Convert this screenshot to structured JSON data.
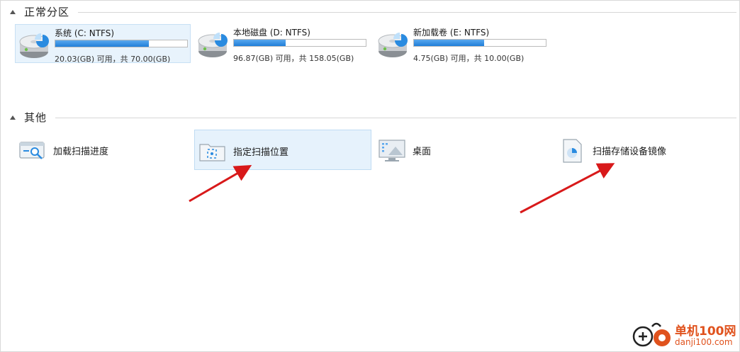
{
  "sections": {
    "normal_partitions": "正常分区",
    "other": "其他"
  },
  "drives": [
    {
      "name": "系统 (C: NTFS)",
      "capacity": "20.03(GB) 可用，共 70.00(GB)",
      "used_fraction": 0.71,
      "selected": true
    },
    {
      "name": "本地磁盘 (D: NTFS)",
      "capacity": "96.87(GB) 可用，共 158.05(GB)",
      "used_fraction": 0.39,
      "selected": false
    },
    {
      "name": "新加载卷 (E: NTFS)",
      "capacity": "4.75(GB) 可用，共 10.00(GB)",
      "used_fraction": 0.53,
      "selected": false
    }
  ],
  "items": [
    {
      "label": "加载扫描进度",
      "icon": "load-scan-progress-icon",
      "selected": false
    },
    {
      "label": "指定扫描位置",
      "icon": "folder-scan-icon",
      "selected": true
    },
    {
      "label": "桌面",
      "icon": "desktop-icon",
      "selected": false
    },
    {
      "label": "扫描存储设备镜像",
      "icon": "disk-image-icon",
      "selected": false
    }
  ],
  "watermark": {
    "title": "单机100网",
    "url": "danji100.com"
  },
  "colors": {
    "bar_fill": "#1f7fd9",
    "selection_bg": "#e6f2fc",
    "arrow": "#d8191a",
    "watermark": "#e0521d"
  }
}
